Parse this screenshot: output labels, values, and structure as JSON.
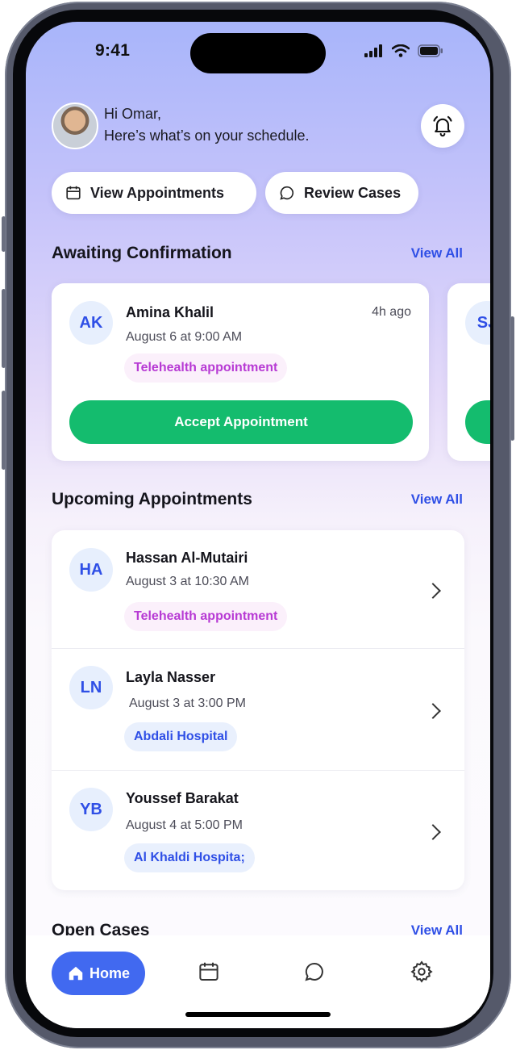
{
  "status_bar": {
    "time": "9:41"
  },
  "header": {
    "greeting": "Hi Omar,",
    "subtitle": "Here’s what’s on your schedule."
  },
  "actions": [
    {
      "label": "View Appointments",
      "icon": "calendar-icon"
    },
    {
      "label": "Review Cases",
      "icon": "chat-bubble-icon"
    }
  ],
  "awaiting": {
    "title": "Awaiting Confirmation",
    "view_all": "View All",
    "card": {
      "initials": "AK",
      "name": "Amina Khalil",
      "time_ago": "4h ago",
      "date": "August 6 at 9:00 AM",
      "tag": "Telehealth appointment",
      "accept_label": "Accept Appointment"
    },
    "next_card_initials": "SJ"
  },
  "upcoming": {
    "title": "Upcoming Appointments",
    "view_all": "View All",
    "items": [
      {
        "initials": "HA",
        "name": "Hassan Al-Mutairi",
        "date": "August 3 at 10:30 AM",
        "tag": "Telehealth appointment",
        "tag_type": "telehealth"
      },
      {
        "initials": "LN",
        "name": "Layla Nasser",
        "date": "August 3 at 3:00 PM",
        "tag": "Abdali Hospital",
        "tag_type": "hospital"
      },
      {
        "initials": "YB",
        "name": "Youssef Barakat",
        "date": "August 4 at 5:00 PM",
        "tag": "Al Khaldi Hospita;",
        "tag_type": "hospital"
      }
    ]
  },
  "open_cases": {
    "title": "Open Cases",
    "view_all": "View All"
  },
  "tabbar": {
    "home_label": "Home",
    "tabs": [
      "home-icon",
      "calendar-icon",
      "chat-icon",
      "settings-icon"
    ]
  },
  "colors": {
    "accent": "#4169f0",
    "success": "#14bc6e",
    "telehealth": "#b73ad4"
  }
}
